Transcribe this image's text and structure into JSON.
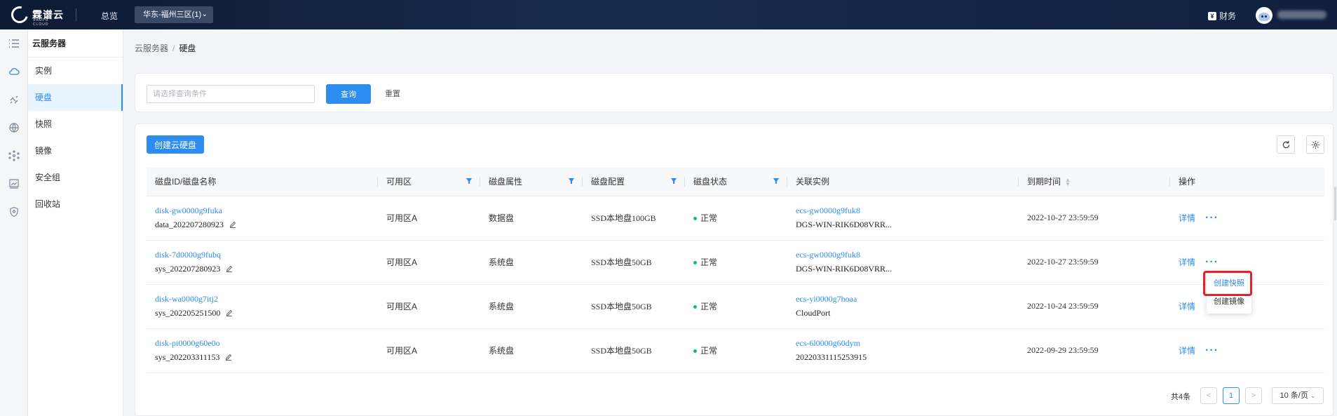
{
  "topbar": {
    "logo_text": "霖谱云",
    "logo_sub": "XAOPU CLOUD",
    "overview": "总览",
    "region": "华东-福州三区(1)",
    "finance": "财务",
    "finance_icon": "¥"
  },
  "rail": [
    "list-icon",
    "cloud-icon",
    "satellite-icon",
    "globe-icon",
    "network-icon",
    "image-icon",
    "shield-icon"
  ],
  "sidebar": {
    "title": "云服务器",
    "items": [
      {
        "label": "实例"
      },
      {
        "label": "硬盘"
      },
      {
        "label": "快照"
      },
      {
        "label": "镜像"
      },
      {
        "label": "安全组"
      },
      {
        "label": "回收站"
      }
    ],
    "active_index": 1
  },
  "breadcrumb": {
    "parent": "云服务器",
    "sep": "/",
    "current": "硬盘"
  },
  "search": {
    "placeholder": "请选择查询条件",
    "query_label": "查询",
    "reset_label": "重置"
  },
  "toolbar": {
    "create_label": "创建云硬盘"
  },
  "table": {
    "columns": [
      "磁盘ID/磁盘名称",
      "可用区",
      "磁盘属性",
      "磁盘配置",
      "磁盘状态",
      "关联实例",
      "到期时间",
      "操作"
    ],
    "rows": [
      {
        "id": "disk-gw0000g9fuka",
        "name": "data_202207280923",
        "zone": "可用区A",
        "attr": "数据盘",
        "config": "SSD本地盘100GB",
        "status": "正常",
        "inst_id": "ecs-gw0000g9fuk8",
        "inst_name": "DGS-WIN-RIK6D08VRR...",
        "expire": "2022-10-27 23:59:59",
        "detail": "详情",
        "more": "···"
      },
      {
        "id": "disk-7d0000g9fubq",
        "name": "sys_202207280923",
        "zone": "可用区A",
        "attr": "系统盘",
        "config": "SSD本地盘50GB",
        "status": "正常",
        "inst_id": "ecs-gw0000g9fuk8",
        "inst_name": "DGS-WIN-RIK6D08VRR...",
        "expire": "2022-10-27 23:59:59",
        "detail": "详情",
        "more": "···"
      },
      {
        "id": "disk-wa0000g7itj2",
        "name": "sys_202205251500",
        "zone": "可用区A",
        "attr": "系统盘",
        "config": "SSD本地盘50GB",
        "status": "正常",
        "inst_id": "ecs-yi0000g7hoaa",
        "inst_name": "CloudPort",
        "expire": "2022-10-24 23:59:59",
        "detail": "详情",
        "more": ""
      },
      {
        "id": "disk-pi0000g60e0o",
        "name": "sys_202203311153",
        "zone": "可用区A",
        "attr": "系统盘",
        "config": "SSD本地盘50GB",
        "status": "正常",
        "inst_id": "ecs-6l0000g60dym",
        "inst_name": "20220331115253915",
        "expire": "2022-09-29 23:59:59",
        "detail": "详情",
        "more": "···"
      }
    ]
  },
  "menu": {
    "items": [
      "创建快照",
      "创建镜像"
    ]
  },
  "pagination": {
    "total": "共4条",
    "prev": "<",
    "page": "1",
    "next": ">",
    "page_size": "10 条/页"
  },
  "colors": {
    "accent": "#2d8cf0",
    "status_ok": "#19be6b",
    "highlight_frame": "#e8202a"
  }
}
